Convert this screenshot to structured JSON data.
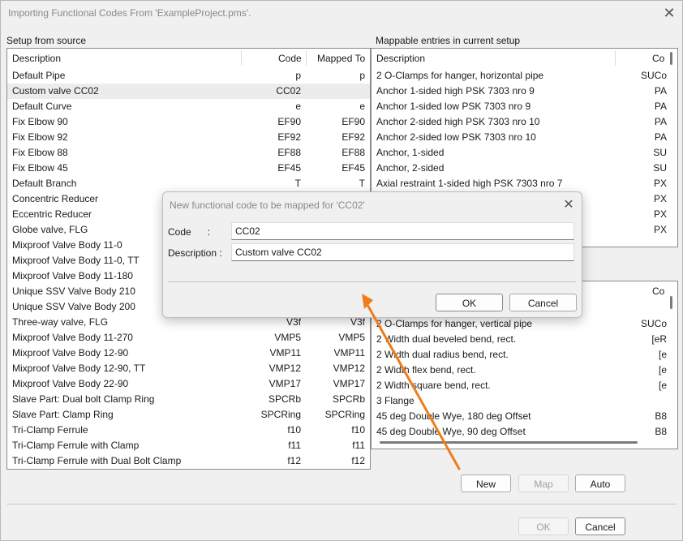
{
  "window": {
    "title": "Importing Functional Codes From 'ExampleProject.pms'."
  },
  "left_panel": {
    "label": "Setup from source",
    "columns": [
      "Description",
      "Code",
      "Mapped To"
    ],
    "rows": [
      {
        "desc": "Default Pipe",
        "code": "p",
        "mapped": "p"
      },
      {
        "desc": "Custom valve CC02",
        "code": "CC02",
        "mapped": ""
      },
      {
        "desc": "Default Curve",
        "code": "e",
        "mapped": "e"
      },
      {
        "desc": "Fix Elbow 90",
        "code": "EF90",
        "mapped": "EF90"
      },
      {
        "desc": "Fix Elbow 92",
        "code": "EF92",
        "mapped": "EF92"
      },
      {
        "desc": "Fix Elbow 88",
        "code": "EF88",
        "mapped": "EF88"
      },
      {
        "desc": "Fix Elbow 45",
        "code": "EF45",
        "mapped": "EF45"
      },
      {
        "desc": "Default Branch",
        "code": "T",
        "mapped": "T"
      },
      {
        "desc": "Concentric Reducer",
        "code": "",
        "mapped": ""
      },
      {
        "desc": "Eccentric Reducer",
        "code": "",
        "mapped": ""
      },
      {
        "desc": "Globe valve, FLG",
        "code": "",
        "mapped": ""
      },
      {
        "desc": "Mixproof Valve Body 11-0",
        "code": "",
        "mapped": ""
      },
      {
        "desc": "Mixproof Valve Body 11-0, TT",
        "code": "",
        "mapped": ""
      },
      {
        "desc": "Mixproof Valve Body 11-180",
        "code": "",
        "mapped": ""
      },
      {
        "desc": "Unique SSV Valve Body 210",
        "code": "",
        "mapped": ""
      },
      {
        "desc": "Unique SSV Valve Body 200",
        "code": "",
        "mapped": ""
      },
      {
        "desc": "Three-way valve, FLG",
        "code": "V3f",
        "mapped": "V3f"
      },
      {
        "desc": "Mixproof Valve Body 11-270",
        "code": "VMP5",
        "mapped": "VMP5"
      },
      {
        "desc": "Mixproof Valve Body 12-90",
        "code": "VMP11",
        "mapped": "VMP11"
      },
      {
        "desc": "Mixproof Valve Body 12-90, TT",
        "code": "VMP12",
        "mapped": "VMP12"
      },
      {
        "desc": "Mixproof Valve Body 22-90",
        "code": "VMP17",
        "mapped": "VMP17"
      },
      {
        "desc": "Slave Part: Dual bolt Clamp Ring",
        "code": "SPCRb",
        "mapped": "SPCRb"
      },
      {
        "desc": "Slave Part: Clamp Ring",
        "code": "SPCRing",
        "mapped": "SPCRing"
      },
      {
        "desc": "Tri-Clamp Ferrule",
        "code": "f10",
        "mapped": "f10"
      },
      {
        "desc": "Tri-Clamp Ferrule with Clamp",
        "code": "f11",
        "mapped": "f11"
      },
      {
        "desc": "Tri-Clamp Ferrule with Dual Bolt Clamp",
        "code": "f12",
        "mapped": "f12"
      }
    ]
  },
  "right_panel": {
    "label": "Mappable entries in current setup",
    "columns": [
      "Description",
      "Co"
    ],
    "rows": [
      {
        "desc": "2 O-Clamps for hanger, horizontal pipe",
        "code": "SUCo"
      },
      {
        "desc": "Anchor 1-sided high PSK 7303 nro 9",
        "code": "PA"
      },
      {
        "desc": "Anchor 1-sided low PSK 7303 nro 9",
        "code": "PA"
      },
      {
        "desc": "Anchor 2-sided high PSK 7303 nro 10",
        "code": "PA"
      },
      {
        "desc": "Anchor 2-sided low PSK 7303 nro 10",
        "code": "PA"
      },
      {
        "desc": "Anchor, 1-sided",
        "code": "SU"
      },
      {
        "desc": "Anchor, 2-sided",
        "code": "SU"
      },
      {
        "desc": "Axial restraint 1-sided high PSK 7303 nro 7",
        "code": "PX"
      },
      {
        "desc": "",
        "code": "PX"
      },
      {
        "desc": "",
        "code": "PX"
      },
      {
        "desc": "",
        "code": "PX"
      }
    ]
  },
  "lower_right_panel": {
    "columns": [
      "",
      "Co"
    ],
    "rows": [
      {
        "desc": "2 O-Clamps for hanger, vertical pipe",
        "code": "SUCo"
      },
      {
        "desc": "2 Width dual beveled bend, rect.",
        "code": "[eR"
      },
      {
        "desc": "2 Width dual radius bend, rect.",
        "code": "[e"
      },
      {
        "desc": "2 Width flex bend, rect.",
        "code": "[e"
      },
      {
        "desc": "2 Width square bend, rect.",
        "code": "[e"
      },
      {
        "desc": "3 Flange",
        "code": ""
      },
      {
        "desc": "45 deg Double Wye, 180 deg Offset",
        "code": "B8"
      },
      {
        "desc": "45 deg Double Wye, 90 deg Offset",
        "code": "B8"
      }
    ]
  },
  "buttons": {
    "new": "New",
    "map": "Map",
    "auto": "Auto",
    "ok": "OK",
    "cancel": "Cancel"
  },
  "dialog": {
    "title": "New functional code to be mapped for 'CC02'",
    "code_label": "Code      :",
    "code_value": "CC02",
    "desc_label": "Description :",
    "desc_value": "Custom valve CC02",
    "ok": "OK",
    "cancel": "Cancel"
  },
  "colors": {
    "arrow": "#ee7d1a",
    "selected_row": "#ececec"
  }
}
